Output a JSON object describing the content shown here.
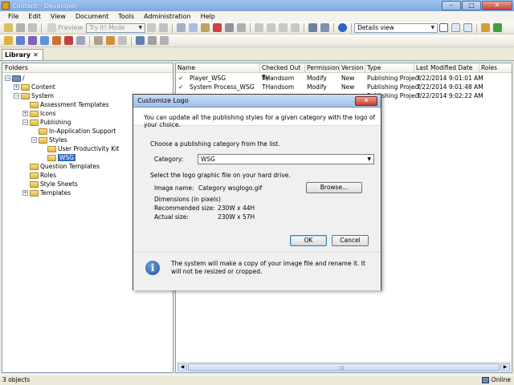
{
  "window": {
    "title": "Content - Developer",
    "buttons": {
      "minimize": "–",
      "maximize": "□",
      "close": "✕"
    }
  },
  "menu": [
    "File",
    "Edit",
    "View",
    "Document",
    "Tools",
    "Administration",
    "Help"
  ],
  "toolbar": {
    "preview_label": "Preview",
    "mode_combo": "Try It! Mode",
    "view_combo": "Details view"
  },
  "library_tab": {
    "label": "Library",
    "close": "✕"
  },
  "folders": {
    "header": "Folders",
    "tree": [
      {
        "label": "/",
        "expander": "−"
      },
      {
        "label": "Content",
        "expander": "+"
      },
      {
        "label": "System",
        "expander": "−"
      },
      {
        "label": "Assessment Templates",
        "expander": ""
      },
      {
        "label": "Icons",
        "expander": "+"
      },
      {
        "label": "Publishing",
        "expander": "−"
      },
      {
        "label": "In-Application Support",
        "expander": ""
      },
      {
        "label": "Styles",
        "expander": "−"
      },
      {
        "label": "User Productivity Kit",
        "expander": ""
      },
      {
        "label": "WSG",
        "expander": ""
      },
      {
        "label": "Question Templates",
        "expander": ""
      },
      {
        "label": "Roles",
        "expander": ""
      },
      {
        "label": "Style Sheets",
        "expander": ""
      },
      {
        "label": "Templates",
        "expander": "+"
      }
    ]
  },
  "list": {
    "columns": [
      "Name",
      "Checked Out By",
      "Permission",
      "Version",
      "Type",
      "Last Modified Date",
      "Roles"
    ],
    "rows": [
      {
        "name": "Player_WSG",
        "checked_out_by": "THandsom",
        "permission": "Modify",
        "version": "New",
        "type": "Publishing Project",
        "modified": "7/22/2014 9:01:01 AM"
      },
      {
        "name": "System Process_WSG",
        "checked_out_by": "THandsom",
        "permission": "Modify",
        "version": "New",
        "type": "Publishing Project",
        "modified": "7/22/2014 9:01:48 AM"
      },
      {
        "name": "",
        "checked_out_by": "",
        "permission": "",
        "version": "",
        "type": "Publishing Project",
        "modified": "7/22/2014 9:02:22 AM"
      }
    ]
  },
  "status": {
    "objects": "3 objects",
    "connection": "Online"
  },
  "dialog": {
    "title": "Customize Logo",
    "close": "✕",
    "intro": "You can update all the publishing styles for a given category with the logo of your choice.",
    "choose_text": "Choose a publishing category from the list.",
    "category_label": "Category:",
    "category_value": "WSG",
    "select_file_text": "Select the logo graphic file on your hard drive.",
    "image_name_label": "Image name:",
    "image_name_value": "Category wsglogo.gif",
    "browse_button": "Browse...",
    "dimensions_label": "Dimensions (in pixels)",
    "recommended_label": "Recommended size:",
    "recommended_value": "230W x 44H",
    "actual_label": "Actual size:",
    "actual_value": "230W x 57H",
    "ok_button": "OK",
    "cancel_button": "Cancel",
    "info_text": "The system will make a copy of your image file and rename it. It will not be resized or cropped.",
    "info_glyph": "i"
  },
  "colors": {
    "selection": "#316ac5",
    "check": "#2a9a2a",
    "titlebar": "#9fc4f0"
  }
}
